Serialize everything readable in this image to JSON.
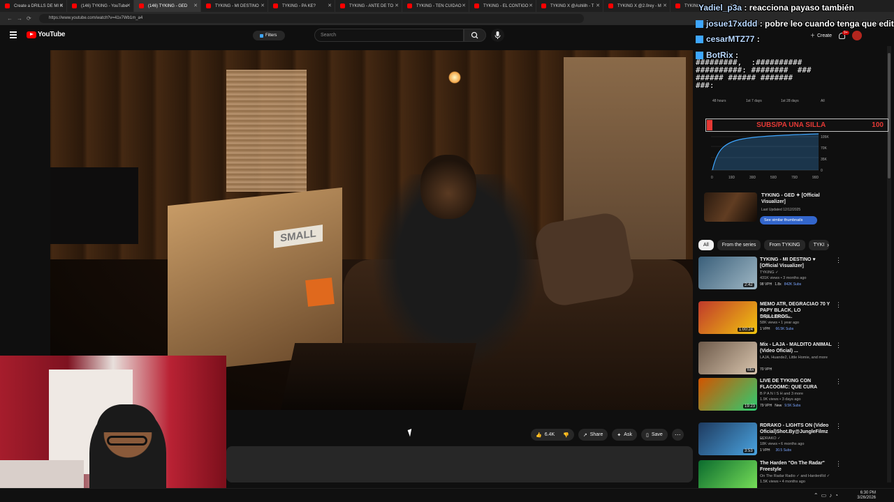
{
  "browser": {
    "tabs": [
      {
        "label": "Create a DRILLS DE MI K"
      },
      {
        "label": "(146) TYKING - YouTube"
      },
      {
        "label": "(146) TYKING - GED"
      },
      {
        "label": "TYKING - MI DESTINO"
      },
      {
        "label": "TYKING - PA KE?"
      },
      {
        "label": "TYKING - ANTE DE TO"
      },
      {
        "label": "TYKING - TEN CUIDAO"
      },
      {
        "label": "TYKING - EL CONTIGO"
      },
      {
        "label": "TYKING X @Ashlilh - T"
      },
      {
        "label": "TYKING X @2.0rey - M"
      },
      {
        "label": "TYKING"
      }
    ],
    "url": "https://www.youtube.com/watch?v=41v7Wb1m_a4"
  },
  "youtube": {
    "logo_text": "YouTube",
    "filters_label": "Filters",
    "search_placeholder": "Search",
    "create_label": "Create",
    "notif_count": "9+"
  },
  "actions": {
    "likes": "6.4K",
    "share": "Share",
    "ask": "Ask",
    "save": "Save"
  },
  "chat": [
    {
      "user": "Yadiel_p3a",
      "message": "reacciona payaso también"
    },
    {
      "user": "josue17xddd",
      "message": "pobre leo cuando tenga que edit"
    },
    {
      "user": "cesarMTZ77",
      "message": ""
    },
    {
      "user": "BotRix",
      "message": ""
    }
  ],
  "chat_glitch": "#########,  :##########\n##########: ########  ###\n###### ###### #######\n###:",
  "goal": {
    "label": "SUBS/PA UNA SILLA",
    "target": "100",
    "progress": 0.03
  },
  "analytics": {
    "stat_top": "275.5K",
    "ranges": [
      "48 hours",
      "1st 7 days",
      "1st 28 days",
      "All"
    ],
    "y_ticks": [
      "105K",
      "70K",
      "35K",
      "0"
    ],
    "x_ticks": [
      "0",
      "19D",
      "39D",
      "59D",
      "79D",
      "99D"
    ],
    "video_title": "TYKING - GED ✦ [Official Visualizer]",
    "updated": "Last Updated 12/12/2025",
    "similar_btn": "See similar thumbnails"
  },
  "chips": [
    "All",
    "From the series",
    "From TYKING",
    "TYKI"
  ],
  "recommendations": [
    {
      "title": "TYKING - MI DESTINO ♥ [Official Visualizer]",
      "channel": "TYKING ✓",
      "views": "431K views • 3 months ago",
      "vph": "98 VPH",
      "ratio": "1.8x",
      "subs": "842K Subs",
      "duration": "2:42",
      "color1": "#3a5f7a",
      "color2": "#9fb7c4"
    },
    {
      "title": "MEMO ATR, DEGRACIAO 70 Y PAPY BLACK, LO DRILLEROS...",
      "channel": "Brayan24TvShow",
      "views": "58K views • 1 year ago",
      "vph": "1 VPH",
      "ratio": "",
      "subs": "66.5K Subs",
      "duration": "1:00:24",
      "color1": "#c0392b",
      "color2": "#f1c40f"
    },
    {
      "title": "Mix - LAJA - MALDITO ANIMAL (Video Oficial) ...",
      "channel": "LAJA, Huande2, Little Homie, and more",
      "views": "",
      "vph": "70 VPH",
      "ratio": "",
      "subs": "",
      "duration": "Mix",
      "color1": "#6d5a4a",
      "color2": "#d8c4ad"
    },
    {
      "title": "LIVE DE TYKING CON FLACOOMC: QUE CURA",
      "channel": "B P A N I S H and 3 more",
      "views": "1.9K views • 3 days ago",
      "vph": "79 VPH",
      "ratio": "New",
      "subs": "9.5K Subs",
      "duration": "19:23",
      "color1": "#d35400",
      "color2": "#2ecc71"
    },
    {
      "title": "RDRAKO - LIGHTS ON (Video Oficial)Shot.By@JungleFilmz ...",
      "channel": "RDRAKO ✓",
      "views": "18K views • 6 months ago",
      "vph": "1 VPH",
      "ratio": "",
      "subs": "30.5 Subs",
      "duration": "3:53",
      "color1": "#1e3a5f",
      "color2": "#4aa3df"
    },
    {
      "title": "The Harden \"On The Radar\" Freestyle",
      "channel": "On The Radar Radio ✓ and HardenRd ✓",
      "views": "1.5K views • 4 months ago",
      "vph": "",
      "ratio": "",
      "subs": "",
      "duration": "",
      "color1": "#0b6b2e",
      "color2": "#7be35a"
    }
  ],
  "taskbar": {
    "time": "6:30 PM",
    "date": "3/26/2026"
  }
}
